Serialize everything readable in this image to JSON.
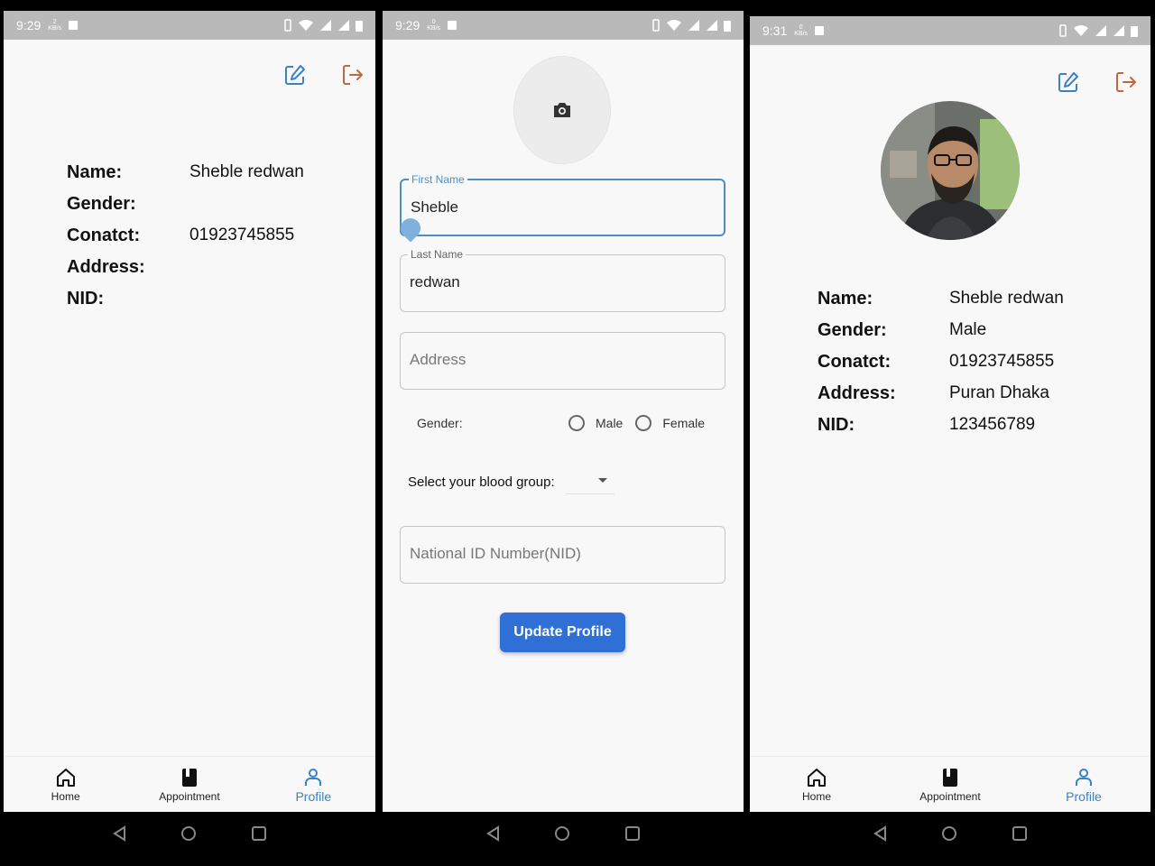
{
  "screen1": {
    "status": {
      "time": "9:29",
      "speed": "2",
      "speed_unit": "KB/s"
    },
    "profile": [
      {
        "label": "Name:",
        "value": "Sheble redwan"
      },
      {
        "label": "Gender:",
        "value": ""
      },
      {
        "label": "Conatct:",
        "value": "01923745855"
      },
      {
        "label": "Address:",
        "value": ""
      },
      {
        "label": "NID:",
        "value": ""
      }
    ],
    "nav": {
      "home": "Home",
      "appointment": "Appointment",
      "profile": "Profile"
    }
  },
  "screen2": {
    "status": {
      "time": "9:29",
      "speed": "0",
      "speed_unit": "KB/s"
    },
    "first_name": {
      "label": "First Name",
      "value": "Sheble"
    },
    "last_name": {
      "label": "Last Name",
      "value": "redwan"
    },
    "address": {
      "placeholder": "Address"
    },
    "gender": {
      "label": "Gender:",
      "options": [
        "Male",
        "Female"
      ]
    },
    "blood": {
      "label": "Select your blood group:"
    },
    "nid": {
      "placeholder": "National ID Number(NID)"
    },
    "update_button": "Update Profile"
  },
  "screen3": {
    "status": {
      "time": "9:31",
      "speed": "0",
      "speed_unit": "KB/s"
    },
    "profile": [
      {
        "label": "Name:",
        "value": "Sheble redwan"
      },
      {
        "label": "Gender:",
        "value": "Male"
      },
      {
        "label": "Conatct:",
        "value": "01923745855"
      },
      {
        "label": "Address:",
        "value": "Puran Dhaka"
      },
      {
        "label": "NID:",
        "value": "123456789"
      }
    ],
    "nav": {
      "home": "Home",
      "appointment": "Appointment",
      "profile": "Profile"
    }
  },
  "colors": {
    "accent": "#3b82c4",
    "logout": "#c0683a",
    "button": "#2f6fd6",
    "statusbar": "#b9b9b9"
  },
  "icons": [
    "edit-icon",
    "logout-icon",
    "camera-icon",
    "home-icon",
    "appointment-icon",
    "profile-icon",
    "back-icon",
    "home-circle-icon",
    "recents-icon"
  ]
}
